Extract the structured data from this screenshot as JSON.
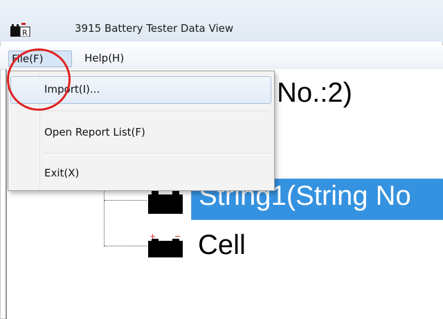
{
  "window": {
    "title": "3915 Battery Tester Data View",
    "icon": "battery-tester-app-icon"
  },
  "menubar": {
    "file_label": "File(F)",
    "help_label": "Help(H)"
  },
  "file_menu": {
    "items": [
      {
        "label": "Import(I)..."
      },
      {
        "label": "Open Report List(F)"
      },
      {
        "label": "Exit(X)"
      }
    ]
  },
  "tree": {
    "root_label": "No.:2)",
    "selected_label": "String1(String No",
    "child_label": "Cell",
    "icon": "battery-icon"
  },
  "colors": {
    "selection": "#3592e0",
    "annotation": "#e02020"
  }
}
